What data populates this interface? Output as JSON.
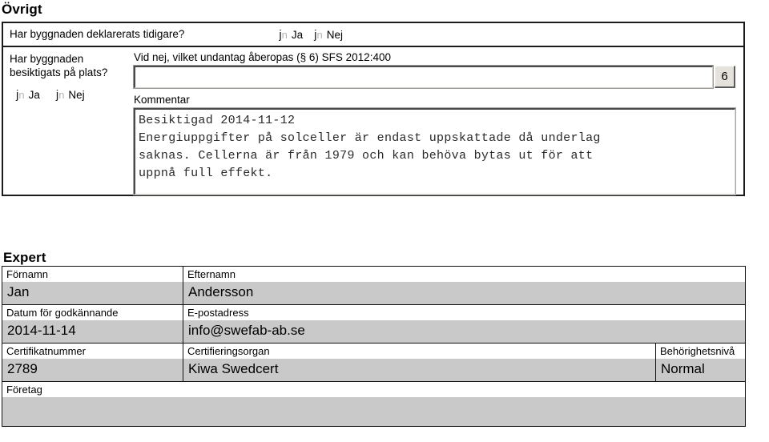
{
  "sections": {
    "ovrigt": {
      "heading": "Övrigt",
      "declared_question": "Har byggnaden deklarerats tidigare?",
      "declared_options": [
        {
          "glyph_j": "j",
          "glyph_n": "n",
          "label": "Ja",
          "selected": false
        },
        {
          "glyph_j": "j",
          "glyph_n": "n",
          "label": "Nej",
          "selected": false
        }
      ],
      "inspected_question_line1": "Har byggnaden",
      "inspected_question_line2": "besiktigats på plats?",
      "inspected_options": [
        {
          "glyph_j": "j",
          "glyph_n": "n",
          "label": "Ja",
          "selected": false
        },
        {
          "glyph_j": "j",
          "glyph_n": "n",
          "label": "Nej",
          "selected": false
        }
      ],
      "exception_label": "Vid nej, vilket undantag åberopas (§ 6) SFS 2012:400",
      "exception_value": "",
      "exception_placeholder": "",
      "spinner_value": "6",
      "comment_label": "Kommentar",
      "comment_value": "Besiktigad 2014-11-12\nEnergiuppgifter på solceller är endast uppskattade då underlag\nsaknas. Cellerna är från 1979 och kan behöva bytas ut för att\nuppnå full effekt."
    },
    "expert": {
      "heading": "Expert",
      "fields": {
        "firstname_label": "Förnamn",
        "firstname_value": "Jan",
        "lastname_label": "Efternamn",
        "lastname_value": "Andersson",
        "approval_date_label": "Datum för godkännande",
        "approval_date_value": "2014-11-14",
        "email_label": "E-postadress",
        "email_value": "info@swefab-ab.se",
        "certificate_number_label": "Certifikatnummer",
        "certificate_number_value": "2789",
        "certification_body_label": "Certifieringsorgan",
        "certification_body_value": "Kiwa Swedcert",
        "authorization_level_label": "Behörighetsnivå",
        "authorization_level_value": "Normal",
        "company_label": "Företag",
        "company_value": ""
      }
    }
  },
  "colors": {
    "value_row_background": "#c9c9c9",
    "border": "#111111",
    "text": "#000000",
    "spinner_background": "#e4e2da"
  }
}
